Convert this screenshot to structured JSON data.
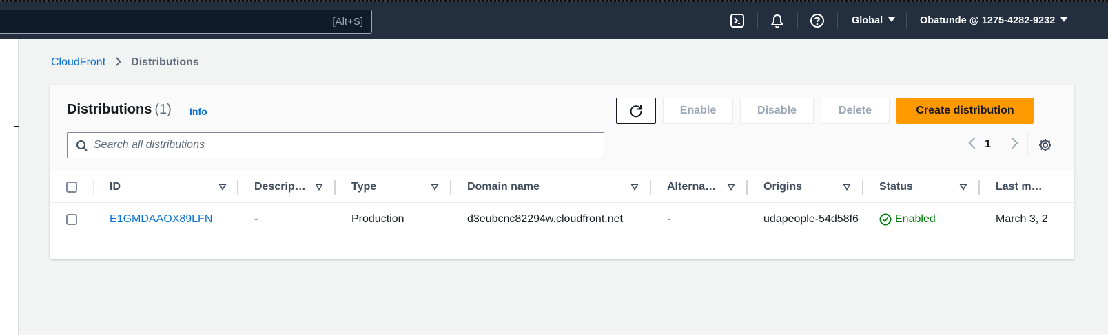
{
  "topbar": {
    "search_hint": "[Alt+S]",
    "region": "Global",
    "account": "Obatunde @ 1275-4282-9232",
    "icons": [
      "cloudshell-icon",
      "bell-icon",
      "help-icon"
    ]
  },
  "breadcrumb": {
    "service": "CloudFront",
    "current": "Distributions"
  },
  "panel": {
    "title": "Distributions",
    "count": "(1)",
    "info": "Info",
    "buttons": {
      "enable": "Enable",
      "disable": "Disable",
      "delete": "Delete",
      "create": "Create distribution"
    },
    "search_placeholder": "Search all distributions",
    "page": "1"
  },
  "table": {
    "columns": [
      "ID",
      "Descrip…",
      "Type",
      "Domain name",
      "Alterna…",
      "Origins",
      "Status",
      "Last m…"
    ],
    "rows": [
      {
        "id": "E1GMDAAOX89LFN",
        "description": "-",
        "type": "Production",
        "domain": "d3eubcnc82294w.cloudfront.net",
        "alternate": "-",
        "origins": "udapeople-54d58f6",
        "status": "Enabled",
        "last_modified": "March 3, 2"
      }
    ]
  },
  "colors": {
    "topbar": "#232f3e",
    "primary_button": "#ff9900",
    "link": "#0972d3",
    "status_ok": "#037f0c"
  }
}
